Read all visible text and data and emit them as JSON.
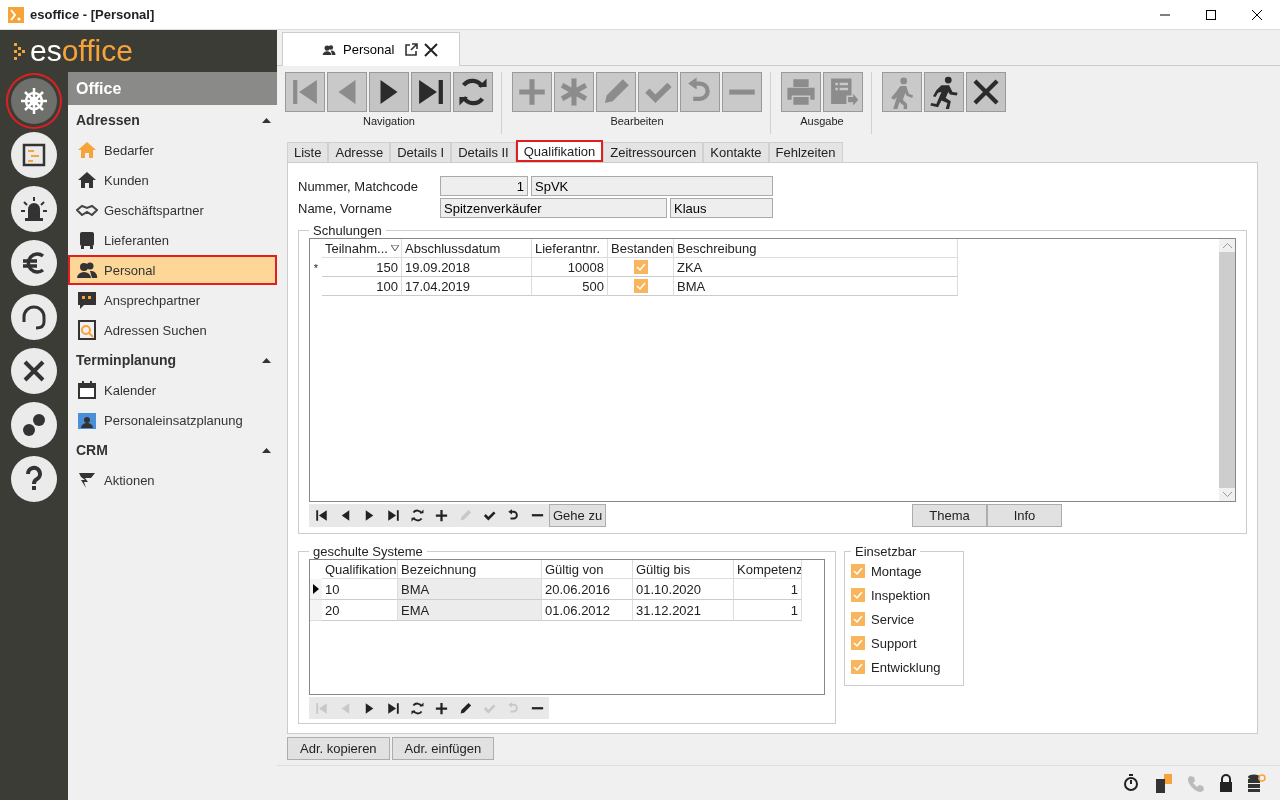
{
  "window": {
    "title": "esoffice - [Personal]"
  },
  "logo": {
    "first": "es",
    "second": "office"
  },
  "rail": [
    {
      "selected": true
    },
    {
      "selected": false
    },
    {
      "selected": false
    },
    {
      "selected": false
    },
    {
      "selected": false
    },
    {
      "selected": false
    },
    {
      "selected": false
    },
    {
      "selected": false
    }
  ],
  "sidebar": {
    "title": "Office",
    "groups": [
      {
        "label": "Adressen",
        "expanded": true,
        "items": [
          {
            "label": "Bedarfer",
            "selected": false
          },
          {
            "label": "Kunden",
            "selected": false
          },
          {
            "label": "Geschäftspartner",
            "selected": false
          },
          {
            "label": "Lieferanten",
            "selected": false
          },
          {
            "label": "Personal",
            "selected": true
          },
          {
            "label": "Ansprechpartner",
            "selected": false
          },
          {
            "label": "Adressen Suchen",
            "selected": false
          }
        ]
      },
      {
        "label": "Terminplanung",
        "expanded": true,
        "items": [
          {
            "label": "Kalender",
            "selected": false
          },
          {
            "label": "Personaleinsatzplanung",
            "selected": false
          }
        ]
      },
      {
        "label": "CRM",
        "expanded": true,
        "items": [
          {
            "label": "Aktionen",
            "selected": false
          }
        ]
      }
    ]
  },
  "doc_tab": {
    "label": "Personal"
  },
  "toolbar": [
    {
      "label": "Navigation",
      "buttons": [
        {
          "kind": "first",
          "disabled": true
        },
        {
          "kind": "prev",
          "disabled": true
        },
        {
          "kind": "next",
          "disabled": false
        },
        {
          "kind": "last",
          "disabled": false
        },
        {
          "kind": "refresh",
          "disabled": false
        }
      ]
    },
    {
      "label": "Bearbeiten",
      "buttons": [
        {
          "kind": "add",
          "disabled": true
        },
        {
          "kind": "copy",
          "disabled": true
        },
        {
          "kind": "edit",
          "disabled": true
        },
        {
          "kind": "save",
          "disabled": true
        },
        {
          "kind": "undo",
          "disabled": true
        },
        {
          "kind": "delete",
          "disabled": true
        }
      ]
    },
    {
      "label": "Ausgabe",
      "buttons": [
        {
          "kind": "print",
          "disabled": true
        },
        {
          "kind": "export",
          "disabled": true
        }
      ]
    },
    {
      "buttons": [
        {
          "kind": "walk",
          "disabled": true
        },
        {
          "kind": "run",
          "disabled": false
        },
        {
          "kind": "close",
          "disabled": false
        }
      ]
    }
  ],
  "tabs": [
    {
      "label": "Liste",
      "selected": false
    },
    {
      "label": "Adresse",
      "selected": false
    },
    {
      "label": "Details I",
      "selected": false
    },
    {
      "label": "Details II",
      "selected": false
    },
    {
      "label": "Qualifikation",
      "selected": true
    },
    {
      "label": "Zeitressourcen",
      "selected": false
    },
    {
      "label": "Kontakte",
      "selected": false
    },
    {
      "label": "Fehlzeiten",
      "selected": false
    }
  ],
  "fields": [
    {
      "label": "Nummer, Matchcode",
      "values": [
        "1",
        "SpVK"
      ]
    },
    {
      "label": "Name, Vorname",
      "values": [
        "Spitzenverkäufer",
        "Klaus"
      ]
    }
  ],
  "schulungen": {
    "title": "Schulungen",
    "columns": [
      {
        "label": "Teilnahm...",
        "kind": "number",
        "sorted": true
      },
      {
        "label": "Abschlussdatum",
        "kind": "text",
        "sorted": false
      },
      {
        "label": "Lieferantnr.",
        "kind": "number",
        "sorted": false
      },
      {
        "label": "Bestanden",
        "kind": "check",
        "sorted": false
      },
      {
        "label": "Beschreibung",
        "kind": "text",
        "sorted": false
      }
    ],
    "rows": [
      {
        "marker": "*",
        "cells": [
          "150",
          "19.09.2018",
          "10008",
          true,
          "ZKA"
        ]
      },
      {
        "cells": [
          "100",
          "17.04.2019",
          "500",
          true,
          "BMA"
        ]
      }
    ],
    "nav": [
      {
        "kind": "first",
        "disabled": false
      },
      {
        "kind": "prev",
        "disabled": false
      },
      {
        "kind": "next",
        "disabled": false
      },
      {
        "kind": "last",
        "disabled": false
      },
      {
        "kind": "refresh",
        "disabled": false
      },
      {
        "kind": "add",
        "disabled": false
      },
      {
        "kind": "edit",
        "disabled": true
      },
      {
        "kind": "save",
        "disabled": false
      },
      {
        "kind": "undo",
        "disabled": false
      },
      {
        "kind": "delete",
        "disabled": false
      }
    ],
    "goto": "Gehe zu",
    "buttons": [
      "Thema",
      "Info"
    ]
  },
  "systeme": {
    "title": "geschulte Systeme",
    "columns": [
      {
        "label": "Qualifikation",
        "kind": "text",
        "readonly": false
      },
      {
        "label": "Bezeichnung",
        "kind": "text",
        "readonly": true
      },
      {
        "label": "Gültig von",
        "kind": "text",
        "readonly": false
      },
      {
        "label": "Gültig bis",
        "kind": "text",
        "readonly": false
      },
      {
        "label": "Kompetenz",
        "kind": "number",
        "readonly": false
      }
    ],
    "rows": [
      {
        "current": true,
        "cells": [
          "10",
          "BMA",
          "20.06.2016",
          "01.10.2020",
          "1"
        ]
      },
      {
        "current": false,
        "cells": [
          "20",
          "EMA",
          "01.06.2012",
          "31.12.2021",
          "1"
        ]
      }
    ],
    "nav": [
      {
        "kind": "first",
        "disabled": true
      },
      {
        "kind": "prev",
        "disabled": true
      },
      {
        "kind": "next",
        "disabled": false
      },
      {
        "kind": "last",
        "disabled": false
      },
      {
        "kind": "refresh",
        "disabled": false
      },
      {
        "kind": "add",
        "disabled": false
      },
      {
        "kind": "edit",
        "disabled": false
      },
      {
        "kind": "save",
        "disabled": true
      },
      {
        "kind": "undo",
        "disabled": true
      },
      {
        "kind": "delete",
        "disabled": false
      }
    ]
  },
  "einsetzbar": {
    "title": "Einsetzbar",
    "items": [
      {
        "label": "Montage",
        "checked": true
      },
      {
        "label": "Inspektion",
        "checked": true
      },
      {
        "label": "Service",
        "checked": true
      },
      {
        "label": "Support",
        "checked": true
      },
      {
        "label": "Entwicklung",
        "checked": true
      }
    ]
  },
  "bottom_buttons": [
    "Adr. kopieren",
    "Adr. einfügen"
  ]
}
